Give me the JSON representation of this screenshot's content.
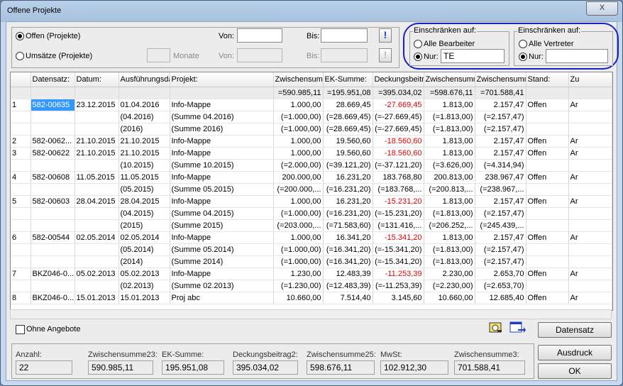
{
  "window": {
    "title": "Offene Projekte",
    "close_glyph": "X"
  },
  "filters": {
    "offen_label": "Offen (Projekte)",
    "umsaetze_label": "Umsätze (Projekte)",
    "monate_label": "Monate",
    "von_label": "Von:",
    "bis_label": "Bis:",
    "von_label2": "Von:",
    "bis_label2": "Bis:",
    "excl": "!"
  },
  "einschraenken1": {
    "title": "Einschränken auf:",
    "alle_label": "Alle Bearbeiter",
    "nur_label": "Nur:",
    "nur_value": "TE"
  },
  "einschraenken2": {
    "title": "Einschränken auf:",
    "alle_label": "Alle Vertreter",
    "nur_label": "Nur:",
    "nur_value": ""
  },
  "table": {
    "columns": [
      "",
      "Datensatz:",
      "Datum:",
      "Ausführungsda",
      "Projekt:",
      "Zwischensumm",
      "EK-Summe:",
      "Deckungsbeitr",
      "Zwischensumm",
      "Zwischensumm",
      "Stand:",
      "Zu"
    ],
    "totals": [
      "",
      "",
      "",
      "",
      "",
      "=590.985,11",
      "=195.951,08",
      "=395.034,02",
      "=598.676,11",
      "=701.588,41",
      "",
      ""
    ],
    "rows": [
      {
        "cells": [
          "1",
          "582-00635",
          "23.12.2015",
          "01.04.2016",
          "Info-Mappe",
          "1.000,00",
          "28.669,45",
          "-27.669,45",
          "1.813,00",
          "2.157,47",
          "Offen",
          "Ar"
        ],
        "red": true,
        "sel": true
      },
      {
        "cells": [
          "",
          "",
          "",
          "(04.2016)",
          "(Summe 04.2016)",
          "(=1.000,00)",
          "(=28.669,45)",
          "(=-27.669,45)",
          "(=1.813,00)",
          "(=2.157,47)",
          "",
          ""
        ]
      },
      {
        "cells": [
          "",
          "",
          "",
          "(2016)",
          "(Summe 2016)",
          "(=1.000,00)",
          "(=28.669,45)",
          "(=-27.669,45)",
          "(=1.813,00)",
          "(=2.157,47)",
          "",
          ""
        ]
      },
      {
        "cells": [
          "2",
          "582-0062...",
          "21.10.2015",
          "21.10.2015",
          "Info-Mappe",
          "1.000,00",
          "19.560,60",
          "-18.560,60",
          "1.813,00",
          "2.157,47",
          "Offen",
          "Ar"
        ],
        "red": true
      },
      {
        "cells": [
          "3",
          "582-00622",
          "21.10.2015",
          "21.10.2015",
          "Info-Mappe",
          "1.000,00",
          "19.560,60",
          "-18.560,60",
          "1.813,00",
          "2.157,47",
          "Offen",
          "Ar"
        ],
        "red": true
      },
      {
        "cells": [
          "",
          "",
          "",
          "(10.2015)",
          "(Summe 10.2015)",
          "(=2.000,00)",
          "(=39.121,20)",
          "(=-37.121,20)",
          "(=3.626,00)",
          "(=4.314,94)",
          "",
          ""
        ]
      },
      {
        "cells": [
          "4",
          "582-00608",
          "11.05.2015",
          "11.05.2015",
          "Info-Mappe",
          "200.000,00",
          "16.231,20",
          "183.768,80",
          "200.813,00",
          "238.967,47",
          "Offen",
          "Ar"
        ]
      },
      {
        "cells": [
          "",
          "",
          "",
          "(05.2015)",
          "(Summe 05.2015)",
          "(=200.000,...",
          "(=16.231,20)",
          "(=183.768,...",
          "(=200.813,...",
          "(=238.967,...",
          "",
          ""
        ]
      },
      {
        "cells": [
          "5",
          "582-00603",
          "28.04.2015",
          "28.04.2015",
          "Info-Mappe",
          "1.000,00",
          "16.231,20",
          "-15.231,20",
          "1.813,00",
          "2.157,47",
          "Offen",
          "Ar"
        ],
        "red": true
      },
      {
        "cells": [
          "",
          "",
          "",
          "(04.2015)",
          "(Summe 04.2015)",
          "(=1.000,00)",
          "(=16.231,20)",
          "(=-15.231,20)",
          "(=1.813,00)",
          "(=2.157,47)",
          "",
          ""
        ]
      },
      {
        "cells": [
          "",
          "",
          "",
          "(2015)",
          "(Summe 2015)",
          "(=203.000,...",
          "(=71.583,60)",
          "(=131.416,...",
          "(=206.252,...",
          "(=245.439,...",
          "",
          ""
        ]
      },
      {
        "cells": [
          "6",
          "582-00544",
          "02.05.2014",
          "02.05.2014",
          "Info-Mappe",
          "1.000,00",
          "16.341,20",
          "-15.341,20",
          "1.813,00",
          "2.157,47",
          "Offen",
          "Ar"
        ],
        "red": true
      },
      {
        "cells": [
          "",
          "",
          "",
          "(05.2014)",
          "(Summe 05.2014)",
          "(=1.000,00)",
          "(=16.341,20)",
          "(=-15.341,20)",
          "(=1.813,00)",
          "(=2.157,47)",
          "",
          ""
        ]
      },
      {
        "cells": [
          "",
          "",
          "",
          "(2014)",
          "(Summe 2014)",
          "(=1.000,00)",
          "(=16.341,20)",
          "(=-15.341,20)",
          "(=1.813,00)",
          "(=2.157,47)",
          "",
          ""
        ]
      },
      {
        "cells": [
          "7",
          "BKZ046-0...",
          "05.02.2013",
          "05.02.2013",
          "Info-Mappe",
          "1.230,00",
          "12.483,39",
          "-11.253,39",
          "2.230,00",
          "2.653,70",
          "Offen",
          "Ar"
        ],
        "red": true
      },
      {
        "cells": [
          "",
          "",
          "",
          "(02.2013)",
          "(Summe 02.2013)",
          "(=1.230,00)",
          "(=12.483,39)",
          "(=-11.253,39)",
          "(=2.230,00)",
          "(=2.653,70)",
          "",
          ""
        ]
      },
      {
        "cells": [
          "8",
          "BKZ046-0...",
          "15.01.2013",
          "15.01.2013",
          "Proj abc",
          "10.660,00",
          "7.514,40",
          "3.145,60",
          "10.660,00",
          "12.685,40",
          "Offen",
          "Ar"
        ]
      }
    ]
  },
  "ohne_angebote": "Ohne Angebote",
  "buttons": {
    "datensatz": "Datensatz",
    "ausdruck": "Ausdruck",
    "ok": "OK"
  },
  "summary": {
    "anzahl_label": "Anzahl:",
    "anzahl": "22",
    "zw23_label": "Zwischensumme23:",
    "zw23": "590.985,11",
    "ek_label": "EK-Summe:",
    "ek": "195.951,08",
    "db2_label": "Deckungsbeitrag2:",
    "db2": "395.034,02",
    "zw25_label": "Zwischensumme25:",
    "zw25": "598.676,11",
    "mwst_label": "MwSt:",
    "mwst": "102.912,30",
    "zw3_label": "Zwischensumme3:",
    "zw3": "701.588,41"
  },
  "icons": {
    "print_preview": "print-preview-icon",
    "export": "export-icon"
  }
}
